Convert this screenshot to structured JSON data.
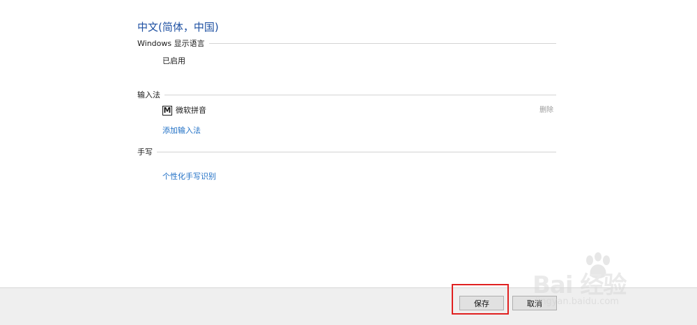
{
  "page": {
    "title": "中文(简体，中国)"
  },
  "sections": {
    "display_language": {
      "header": "Windows 显示语言",
      "status": "已启用"
    },
    "input_methods": {
      "header": "输入法",
      "items": [
        {
          "badge": "M",
          "name": "微软拼音",
          "remove_label": "删除"
        }
      ],
      "add_label": "添加输入法"
    },
    "handwriting": {
      "header": "手写",
      "personalize_label": "个性化手写识别"
    }
  },
  "footer": {
    "save_label": "保存",
    "cancel_label": "取消"
  },
  "watermark": {
    "brand": "Bai  经验",
    "url": "jingyan.baidu.com",
    "logo": "baidu-paw-icon"
  },
  "colors": {
    "title": "#1e50a2",
    "link": "#1f6fc5",
    "highlight": "#e02020",
    "footer_bg": "#efefef"
  }
}
